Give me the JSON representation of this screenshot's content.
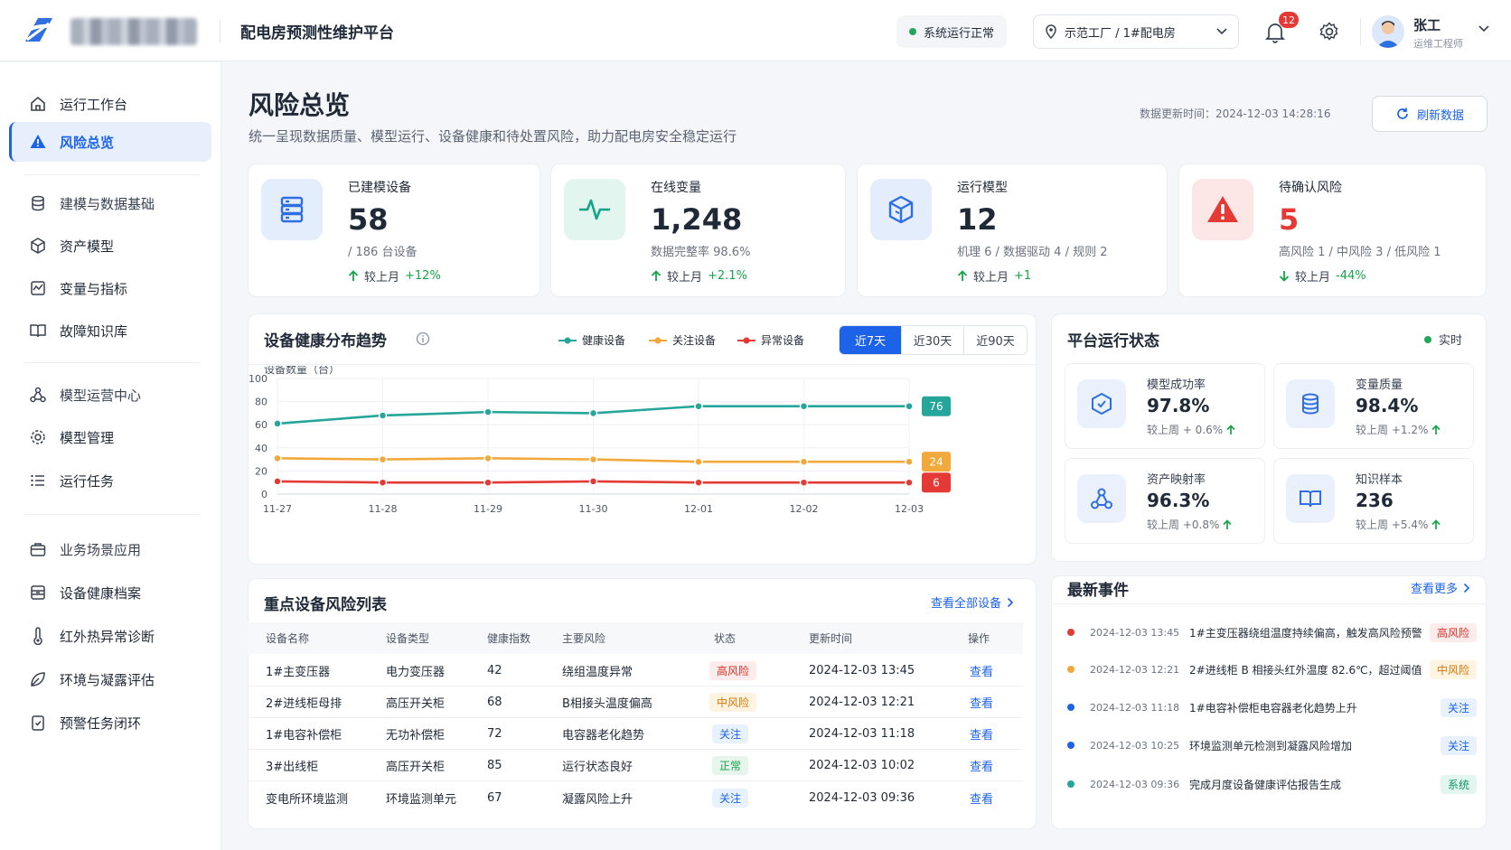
{
  "app": {
    "title": "配电房预测性维护平台"
  },
  "header": {
    "system_status": "系统运行正常",
    "location": "示范工厂 / 1#配电房",
    "notifications": "12",
    "user_name": "张工",
    "user_role": "运维工程师"
  },
  "sidebar": {
    "items": [
      {
        "label": "运行工作台",
        "icon": "home-icon"
      },
      {
        "label": "风险总览",
        "icon": "warning-icon"
      },
      {
        "label": "建模与数据基础",
        "icon": "database-icon"
      },
      {
        "label": "资产模型",
        "icon": "cube-icon"
      },
      {
        "label": "变量与指标",
        "icon": "chart-icon"
      },
      {
        "label": "故障知识库",
        "icon": "book-icon"
      },
      {
        "label": "模型运营中心",
        "icon": "nodes-icon"
      },
      {
        "label": "模型管理",
        "icon": "gear-icon"
      },
      {
        "label": "运行任务",
        "icon": "list-icon"
      },
      {
        "label": "业务场景应用",
        "icon": "briefcase-icon"
      },
      {
        "label": "设备健康档案",
        "icon": "archive-icon"
      },
      {
        "label": "红外热异常诊断",
        "icon": "thermometer-icon"
      },
      {
        "label": "环境与凝露评估",
        "icon": "leaf-icon"
      },
      {
        "label": "预警任务闭环",
        "icon": "checklist-icon"
      }
    ]
  },
  "page": {
    "title": "风险总览",
    "subtitle": "统一呈现数据质量、模型运行、设备健康和待处置风险，助力配电房安全稳定运行",
    "updated": "数据更新时间：2024-12-03  14:28:16",
    "refresh_label": "刷新数据"
  },
  "kpis": [
    {
      "label": "已建模设备",
      "value": "58",
      "sub": "/ 186 台设备",
      "trend_label": "较上月",
      "trend": "+12%",
      "dir": "up",
      "color": "#2f6fe0"
    },
    {
      "label": "在线变量",
      "value": "1,248",
      "sub": "数据完整率 98.6%",
      "trend_label": "较上月",
      "trend": "+2.1%",
      "dir": "up",
      "color": "#15a38a"
    },
    {
      "label": "运行模型",
      "value": "12",
      "sub": "机理 6 / 数据驱动 4 / 规则 2",
      "trend_label": "较上月",
      "trend": "+1",
      "dir": "up",
      "color": "#2f6fe0"
    },
    {
      "label": "待确认风险",
      "value": "5",
      "sub": "高风险 1 / 中风险 3 / 低风险 1",
      "trend_label": "较上月",
      "trend": "-44%",
      "dir": "down",
      "color": "#e53935"
    }
  ],
  "trend_card": {
    "title": "设备健康分布趋势",
    "legend": [
      "健康设备",
      "关注设备",
      "异常设备"
    ],
    "ranges": [
      "近7天",
      "近30天",
      "近90天"
    ],
    "ylabel": "设备数量（台）"
  },
  "chart_data": {
    "type": "line",
    "x": [
      "11-27",
      "11-28",
      "11-29",
      "11-30",
      "12-01",
      "12-02",
      "12-03"
    ],
    "ylim": [
      0,
      100
    ],
    "yticks": [
      0,
      20,
      40,
      60,
      80,
      100
    ],
    "ylabel": "设备数量（台）",
    "series": [
      {
        "name": "健康设备",
        "color": "#26a69a",
        "values": [
          61,
          68,
          71,
          70,
          76,
          76,
          76
        ]
      },
      {
        "name": "关注设备",
        "color": "#f2a93b",
        "values": [
          31,
          30,
          31,
          30,
          28,
          28,
          28
        ]
      },
      {
        "name": "异常设备",
        "color": "#e53935",
        "values": [
          11,
          10,
          10,
          11,
          10,
          10,
          10
        ]
      }
    ],
    "end_labels": [
      "76",
      "24",
      "6"
    ],
    "legend_position": "top-right",
    "grid": true
  },
  "status_card": {
    "title": "平台运行状态",
    "live": "实时",
    "items": [
      {
        "label": "模型成功率",
        "value": "97.8%",
        "trend": "较上周 + 0.6%"
      },
      {
        "label": "变量质量",
        "value": "98.4%",
        "trend": "较上周 +1.2%"
      },
      {
        "label": "资产映射率",
        "value": "96.3%",
        "trend": "较上周 +0.8%"
      },
      {
        "label": "知识样本",
        "value": "236",
        "trend": "较上周 +5.4%"
      }
    ]
  },
  "risk_table": {
    "title": "重点设备风险列表",
    "view_all": "查看全部设备",
    "columns": [
      "设备名称",
      "设备类型",
      "健康指数",
      "主要风险",
      "状态",
      "更新时间",
      "操作"
    ],
    "rows": [
      {
        "name": "1#主变压器",
        "type": "电力变压器",
        "score": "42",
        "risk": "绕组温度异常",
        "status": "高风险",
        "level": "high",
        "time": "2024-12-03 13:45",
        "action": "查看"
      },
      {
        "name": "2#进线柜母排",
        "type": "高压开关柜",
        "score": "68",
        "risk": "B相接头温度偏高",
        "status": "中风险",
        "level": "mid",
        "time": "2024-12-03 12:21",
        "action": "查看"
      },
      {
        "name": "1#电容补偿柜",
        "type": "无功补偿柜",
        "score": "72",
        "risk": "电容器老化趋势",
        "status": "关注",
        "level": "watch",
        "time": "2024-12-03 11:18",
        "action": "查看"
      },
      {
        "name": "3#出线柜",
        "type": "高压开关柜",
        "score": "85",
        "risk": "运行状态良好",
        "status": "正常",
        "level": "ok",
        "time": "2024-12-03 10:02",
        "action": "查看"
      },
      {
        "name": "变电所环境监测",
        "type": "环境监测单元",
        "score": "67",
        "risk": "凝露风险上升",
        "status": "关注",
        "level": "watch",
        "time": "2024-12-03 09:36",
        "action": "查看"
      }
    ]
  },
  "events": {
    "title": "最新事件",
    "more": "查看更多",
    "items": [
      {
        "time": "2024-12-03 13:45",
        "text": "1#主变压器绕组温度持续偏高，触发高风险预警",
        "tag": "高风险",
        "level": "high",
        "color": "#e53935"
      },
      {
        "time": "2024-12-03 12:21",
        "text": "2#进线柜 B 相接头红外温度 82.6℃，超过阈值",
        "tag": "中风险",
        "level": "mid",
        "color": "#f2a93b"
      },
      {
        "time": "2024-12-03 11:18",
        "text": "1#电容补偿柜电容器老化趋势上升",
        "tag": "关注",
        "level": "watch",
        "color": "#1d63e9"
      },
      {
        "time": "2024-12-03 10:25",
        "text": "环境监测单元检测到凝露风险增加",
        "tag": "关注",
        "level": "watch",
        "color": "#1d63e9"
      },
      {
        "time": "2024-12-03 09:36",
        "text": "完成月度设备健康评估报告生成",
        "tag": "系统",
        "level": "sys",
        "color": "#26a69a"
      }
    ]
  }
}
